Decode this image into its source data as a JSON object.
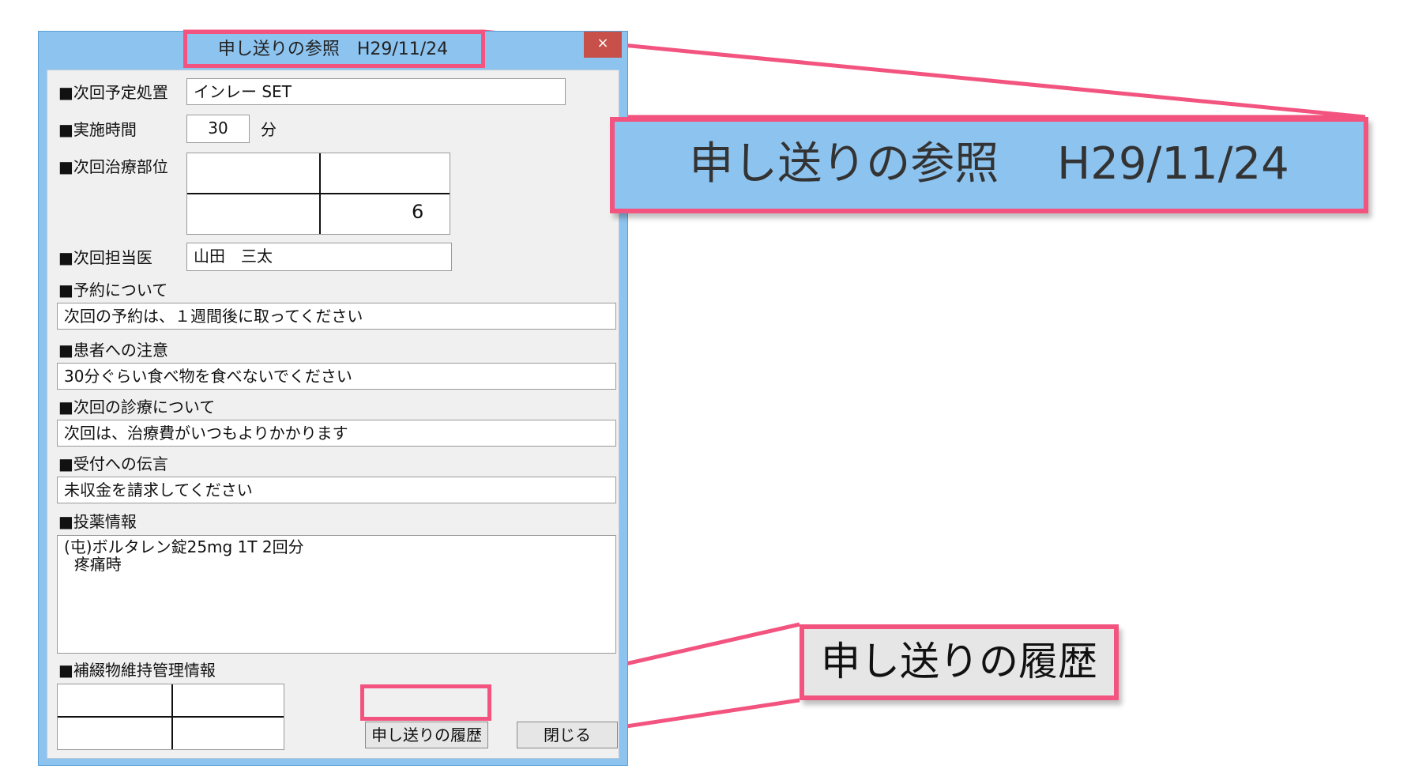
{
  "window": {
    "title": "申し送りの参照　H29/11/24",
    "close_glyph": "×"
  },
  "fields": {
    "next_treatment": {
      "label": "■次回予定処置",
      "value": "インレー SET"
    },
    "duration": {
      "label": "■実施時間",
      "value": "30",
      "unit": "分"
    },
    "treatment_site": {
      "label": "■次回治療部位",
      "value": "6"
    },
    "doctor": {
      "label": "■次回担当医",
      "value": "山田　三太"
    },
    "reservation": {
      "label": "■予約について",
      "value": "次回の予約は、１週間後に取ってください"
    },
    "patient_notes": {
      "label": "■患者への注意",
      "value": "30分ぐらい食べ物を食べないでください"
    },
    "next_consult": {
      "label": "■次回の診療について",
      "value": "次回は、治療費がいつもよりかかります"
    },
    "reception": {
      "label": "■受付への伝言",
      "value": "未収金を請求してください"
    },
    "medication": {
      "label": "■投薬情報",
      "value": "(屯)ボルタレン錠25mg 1T 2回分\n  疼痛時"
    },
    "prosthesis": {
      "label": "■補綴物維持管理情報"
    }
  },
  "buttons": {
    "history": "申し送りの履歴",
    "close": "閉じる"
  },
  "callouts": {
    "title_zoom": "申し送りの参照　 H29/11/24",
    "button_zoom": "申し送りの履歴"
  },
  "colors": {
    "accent": "#f2547f",
    "titlebar": "#8dc3ef",
    "close_button": "#c7504a"
  }
}
